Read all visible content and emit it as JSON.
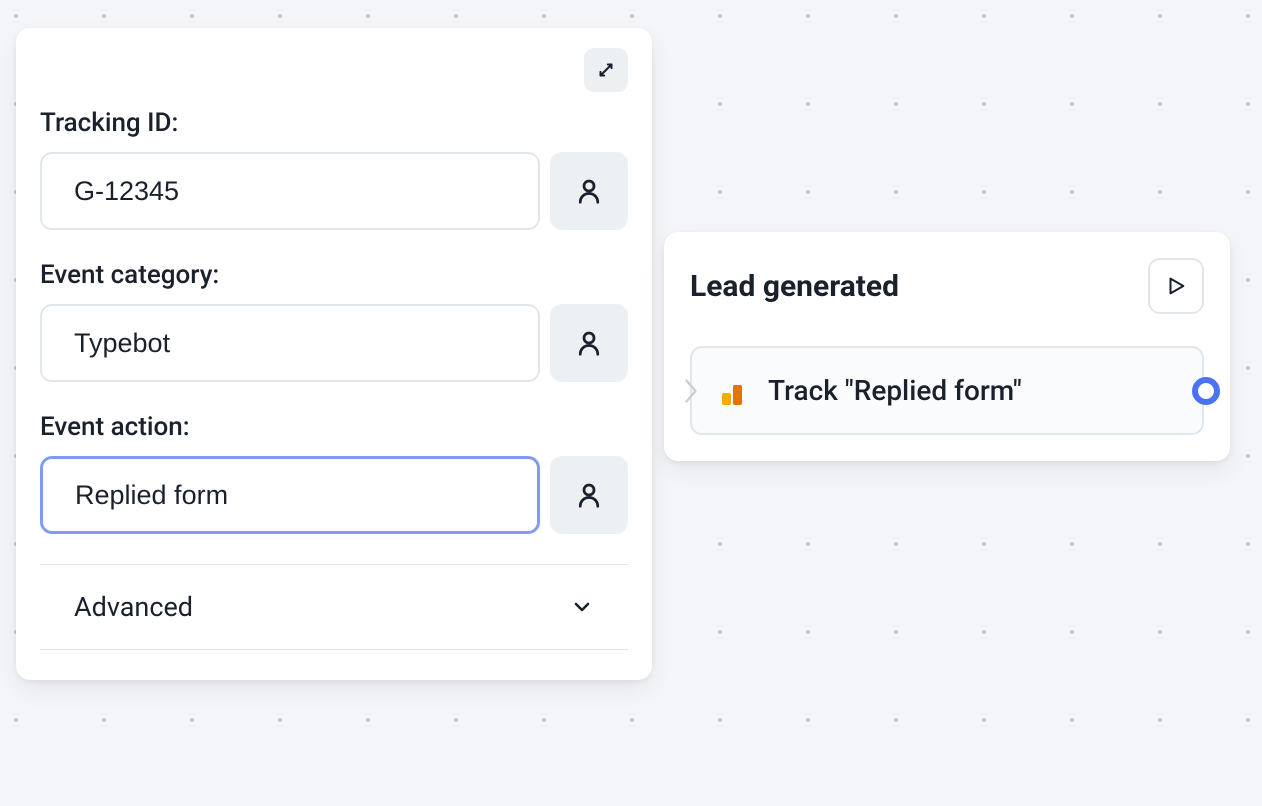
{
  "panel": {
    "fields": {
      "tracking_id": {
        "label": "Tracking ID:",
        "value": "G-12345"
      },
      "event_category": {
        "label": "Event category:",
        "value": "Typebot"
      },
      "event_action": {
        "label": "Event action:",
        "value": "Replied form"
      }
    },
    "advanced_label": "Advanced"
  },
  "node": {
    "title": "Lead generated",
    "track_label": "Track \"Replied form\""
  }
}
